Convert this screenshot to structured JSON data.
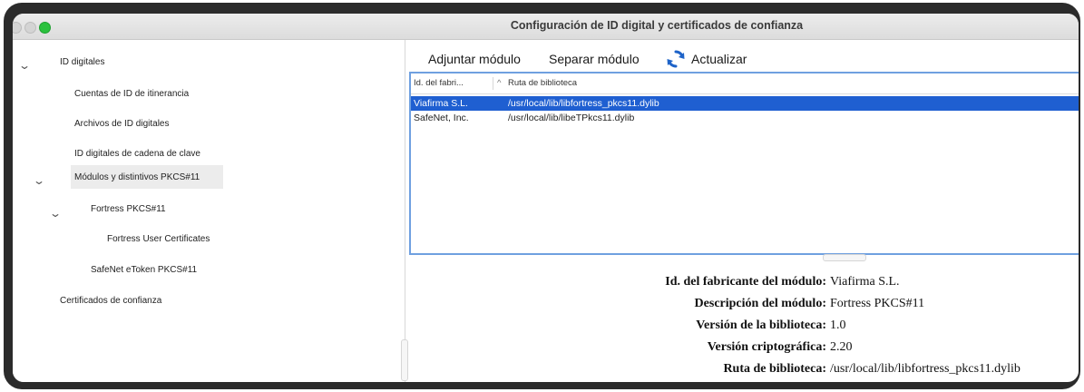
{
  "window": {
    "title": "Configuración de ID digital y certificados de confianza"
  },
  "sidebar": {
    "items": [
      {
        "label": "ID digitales",
        "expanded": true
      },
      {
        "label": "Cuentas de ID de itinerancia"
      },
      {
        "label": "Archivos de ID digitales"
      },
      {
        "label": "ID digitales de cadena de clave"
      },
      {
        "label": "Módulos y distintivos PKCS#11",
        "expanded": true,
        "selected": true
      },
      {
        "label": "Fortress PKCS#11",
        "expanded": true
      },
      {
        "label": "Fortress User Certificates"
      },
      {
        "label": "SafeNet eToken PKCS#11"
      },
      {
        "label": "Certificados de confianza"
      }
    ]
  },
  "toolbar": {
    "attach_label": "Adjuntar módulo",
    "detach_label": "Separar módulo",
    "refresh_label": "Actualizar",
    "refresh_icon": "refresh-icon"
  },
  "table": {
    "columns": [
      "Id. del fabri...",
      "Ruta de biblioteca"
    ],
    "sort_indicator": "^",
    "rows": [
      {
        "manufacturer": "Viafirma S.L.",
        "path": "/usr/local/lib/libfortress_pkcs11.dylib",
        "selected": true
      },
      {
        "manufacturer": "SafeNet, Inc.",
        "path": "/usr/local/lib/libeTPkcs11.dylib",
        "selected": false
      }
    ]
  },
  "details": {
    "rows": [
      {
        "label": "Id. del fabricante del módulo:",
        "value": "Viafirma S.L."
      },
      {
        "label": "Descripción del módulo:",
        "value": "Fortress PKCS#11"
      },
      {
        "label": "Versión de la biblioteca:",
        "value": "1.0"
      },
      {
        "label": "Versión criptográfica:",
        "value": "2.20"
      },
      {
        "label": "Ruta de biblioteca:",
        "value": "/usr/local/lib/libfortress_pkcs11.dylib"
      }
    ]
  },
  "colors": {
    "selection": "#1f5fd1",
    "table_border": "#6fa0e0",
    "green_button": "#2bc13e",
    "refresh_icon": "#1e63c8"
  }
}
